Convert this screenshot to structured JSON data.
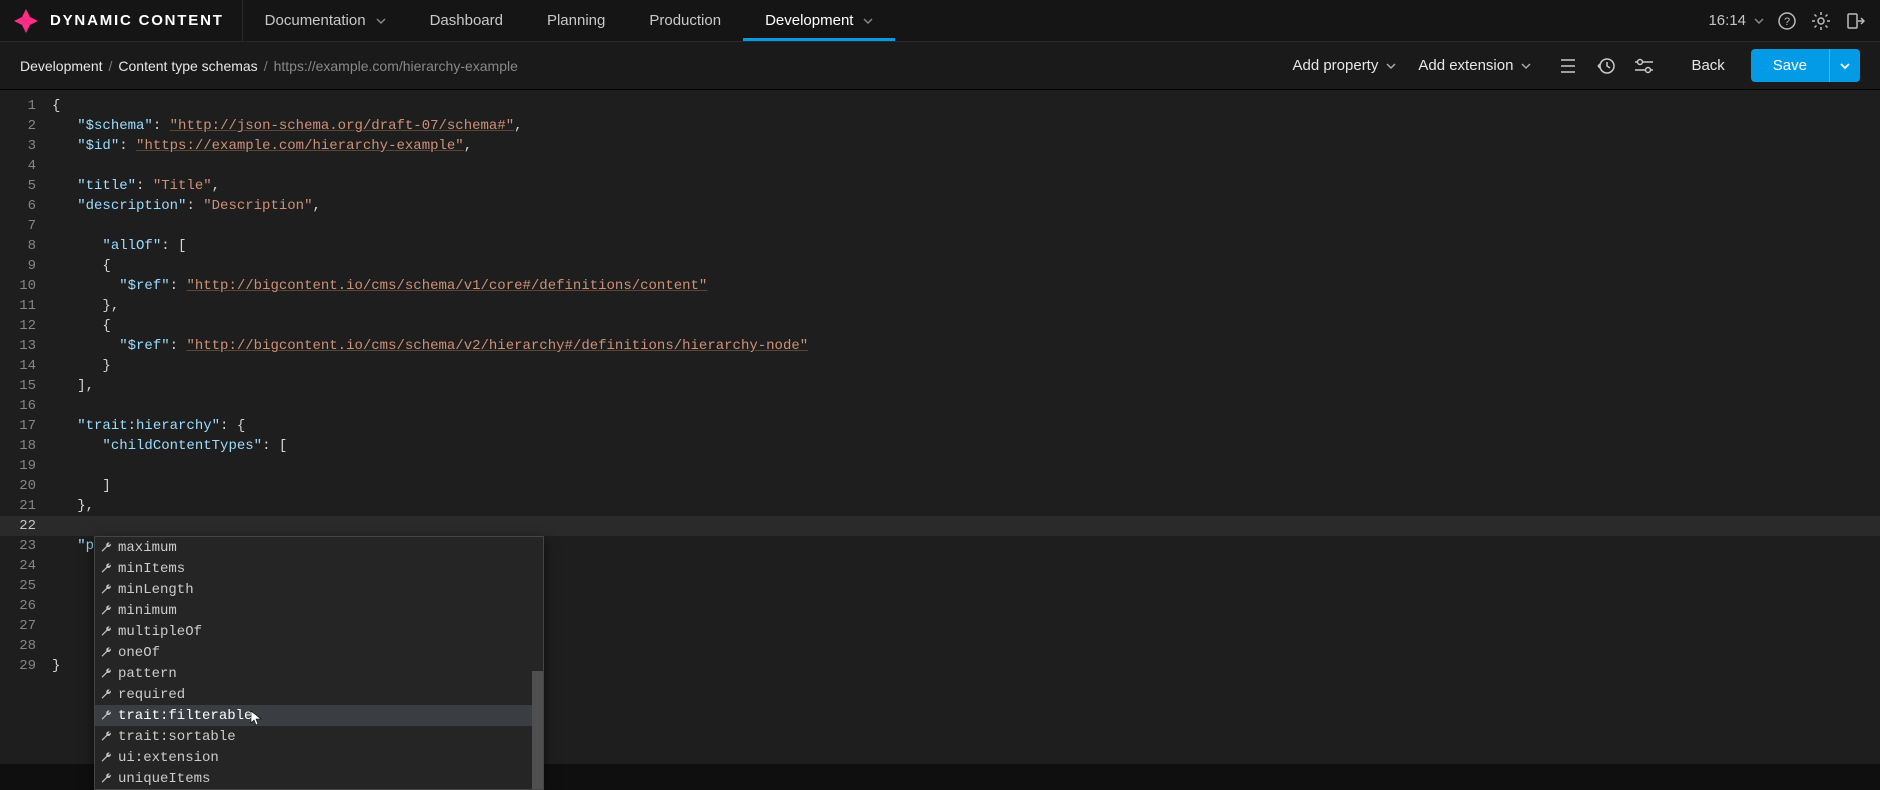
{
  "brand": "DYNAMIC CONTENT",
  "nav": {
    "documentation": "Documentation",
    "dashboard": "Dashboard",
    "planning": "Planning",
    "production": "Production",
    "development": "Development"
  },
  "clock": "16:14",
  "breadcrumbs": {
    "c1": "Development",
    "c2": "Content type schemas",
    "c3": "https://example.com/hierarchy-example"
  },
  "toolbar": {
    "add_property": "Add property",
    "add_extension": "Add extension",
    "back": "Back",
    "save": "Save"
  },
  "code_lines": {
    "l1": "{",
    "l2a": "\"$schema\"",
    "l2b": ": ",
    "l2c": "\"http://json-schema.org/draft-07/schema#\"",
    "l2d": ",",
    "l3a": "\"$id\"",
    "l3b": ": ",
    "l3c": "\"https://example.com/hierarchy-example\"",
    "l3d": ",",
    "l5a": "\"title\"",
    "l5b": ": ",
    "l5c": "\"Title\"",
    "l5d": ",",
    "l6a": "\"description\"",
    "l6b": ": ",
    "l6c": "\"Description\"",
    "l6d": ",",
    "l8a": "\"allOf\"",
    "l8b": ": [",
    "l9": "{",
    "l10a": "\"$ref\"",
    "l10b": ": ",
    "l10c": "\"http://bigcontent.io/cms/schema/v1/core#/definitions/content\"",
    "l11": "},",
    "l12": "{",
    "l13a": "\"$ref\"",
    "l13b": ": ",
    "l13c": "\"http://bigcontent.io/cms/schema/v2/hierarchy#/definitions/hierarchy-node\"",
    "l14": "}",
    "l15": "],",
    "l17a": "\"trait:hierarchy\"",
    "l17b": ": {",
    "l18a": "\"childContentTypes\"",
    "l18b": ": [",
    "l20": "]",
    "l21": "},",
    "l23a": "\"propertyOrder\"",
    "l23b": ": []",
    "l29": "}"
  },
  "gutter": [
    "1",
    "2",
    "3",
    "4",
    "5",
    "6",
    "7",
    "8",
    "9",
    "10",
    "11",
    "12",
    "13",
    "14",
    "15",
    "16",
    "17",
    "18",
    "19",
    "20",
    "21",
    "22",
    "23",
    "24",
    "25",
    "26",
    "27",
    "28",
    "29"
  ],
  "autocomplete": {
    "items": [
      "maximum",
      "minItems",
      "minLength",
      "minimum",
      "multipleOf",
      "oneOf",
      "pattern",
      "required",
      "trait:filterable",
      "trait:sortable",
      "ui:extension",
      "uniqueItems"
    ],
    "selected_index": 8
  }
}
